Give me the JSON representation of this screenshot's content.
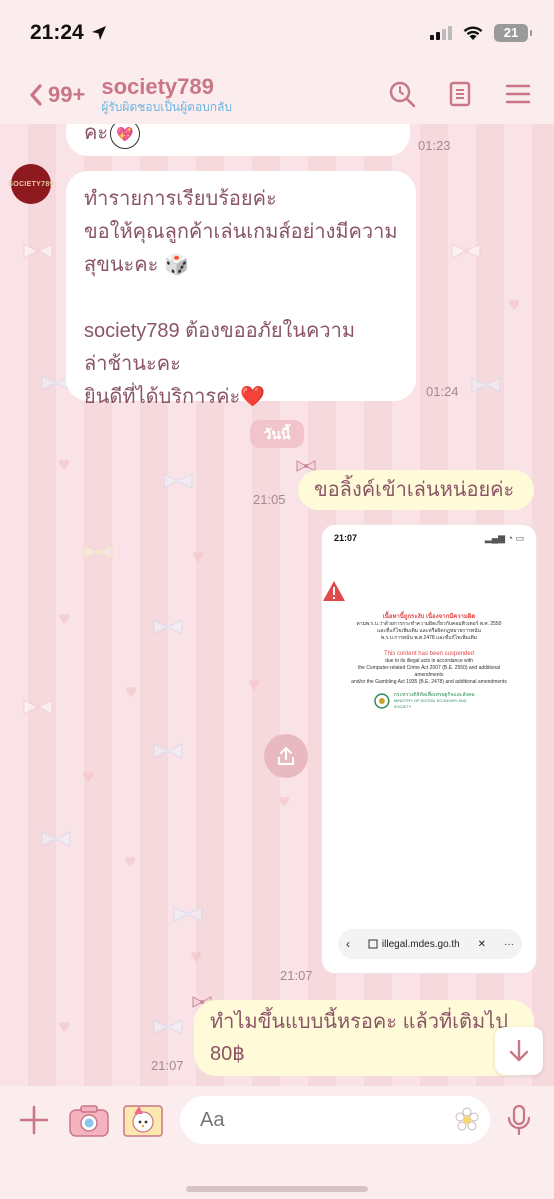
{
  "status_bar": {
    "time": "21:24",
    "battery": "21"
  },
  "header": {
    "back_count": "99+",
    "title": "society789",
    "subtitle": "ผู้รับผิดชอบเป็นผู้ตอบกลับ",
    "icons": [
      "search-icon",
      "notes-icon",
      "menu-icon"
    ]
  },
  "messages": [
    {
      "from": "shop",
      "text_lines": [
        "คะ"
      ],
      "emoji": "💖",
      "time": "01:23"
    },
    {
      "from": "shop",
      "avatar_text": "SOCIETY789",
      "text_lines": [
        "ทำรายการเรียบร้อยค่ะ",
        "ขอให้คุณลูกค้าเล่นเกมส์อย่างมีความ",
        "สุขนะคะ 🎲",
        "",
        "society789 ต้องขออภัยในความ",
        "ล่าช้านะคะ",
        "ยินดีที่ได้บริการค่ะ❤️"
      ],
      "time": "01:24"
    },
    {
      "type": "date",
      "text": "วันนี้"
    },
    {
      "from": "me",
      "text": "ขอลิ้งค์เข้าเล่นหน่อยค่ะ",
      "time": "21:05"
    },
    {
      "from": "me",
      "type": "image",
      "time": "21:07",
      "screenshot": {
        "time": "21:07",
        "lines_th": [
          "เนื้อหานี้ถูกระงับ เนื่องจากมีความผิด",
          "ตามพ.ร.บ.ว่าด้วยการกระทำความผิดเกี่ยวกับคอมพิวเตอร์ พ.ศ. 2550",
          "และที่แก้ไขเพิ่มเติม และหรือผิดกฎหมายการพนัน",
          "พ.ร.บ.การพนัน พ.ศ.2478 และที่แก้ไขเพิ่มเติม"
        ],
        "headline_en": "This content has been suspended",
        "lines_en": [
          "due to its illegal acts in accordance with",
          "the Computer-related Crime Act 2007 (B.E. 2550) and additional amendments",
          "and/or the Gambling Act 1935 (B.E. 2478) and additional amendments"
        ],
        "ministry_th": "กระทรวงดิจิทัลเพื่อเศรษฐกิจและสังคม",
        "ministry_en": "MINISTRY OF DIGITAL ECONOMY AND SOCIETY",
        "url": "illegal.mdes.go.th"
      }
    },
    {
      "from": "me",
      "text_lines": [
        "ทำไมขึ้นแบบนี้หรอคะ แล้วที่เติมไป",
        "80฿"
      ],
      "time": "21:07"
    }
  ],
  "input": {
    "placeholder": "Aa"
  },
  "colors": {
    "accent": "#c97686",
    "subtitle": "#6cb4e0",
    "incoming_bubble": "#ffffff",
    "outgoing_bubble": "#fffbd9",
    "background": "#f7dde0"
  }
}
